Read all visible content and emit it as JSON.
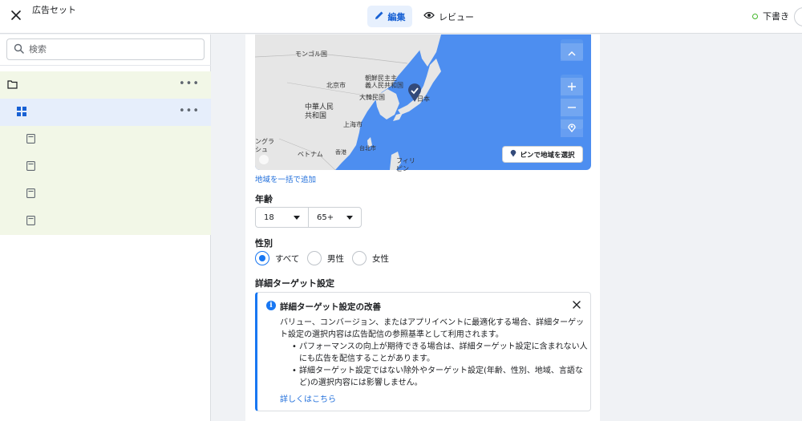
{
  "topbar": {
    "close_icon": "close-icon",
    "title": "広告セット",
    "tabs": [
      {
        "label": "編集",
        "icon": "pencil-icon",
        "active": true
      },
      {
        "label": "レビュー",
        "icon": "eye-icon",
        "active": false
      }
    ],
    "status": "下書き",
    "status_color": "#42b72a"
  },
  "sidebar": {
    "search_placeholder": "検索",
    "tree": [
      {
        "type": "campaign",
        "icon": "folder-icon",
        "more": "•••"
      },
      {
        "type": "ad-set",
        "icon": "grid-icon",
        "more": "•••",
        "selected": true
      },
      {
        "type": "ad",
        "icon": "ad-icon"
      },
      {
        "type": "ad",
        "icon": "ad-icon"
      },
      {
        "type": "ad",
        "icon": "ad-icon"
      },
      {
        "type": "ad",
        "icon": "ad-icon"
      }
    ],
    "row_color": "#f2f7e7",
    "selected_color": "#e6eefb"
  },
  "map": {
    "labels": {
      "mongolia": "モンゴル国",
      "dprk": "朝鮮民主主\n義人民共和国",
      "beijing": "北京市",
      "korea": "大韓民国",
      "japan": "日本",
      "china": "中華人民\n共和国",
      "shanghai": "上海市",
      "bangladesh": "ングラ\nシュ",
      "vietnam": "ベトナム",
      "hongkong": "香港",
      "taipei": "台北市",
      "philippines": "フィリ\nピン"
    },
    "pin_button": "ピンで地域を選択",
    "bulk_add_link": "地域を一括で追加"
  },
  "age": {
    "label": "年齢",
    "min": "18",
    "max": "65+"
  },
  "gender": {
    "label": "性別",
    "options": [
      {
        "label": "すべて",
        "selected": true
      },
      {
        "label": "男性",
        "selected": false
      },
      {
        "label": "女性",
        "selected": false
      }
    ]
  },
  "detailed_targeting": {
    "label": "詳細ターゲット設定",
    "info": {
      "title": "詳細ターゲット設定の改善",
      "body": "バリュー、コンバージョン、またはアプリイベントに最適化する場合、詳細ターゲット設定の選択内容は広告配信の参照基準として利用されます。",
      "bullets": [
        "パフォーマンスの向上が期待できる場合は、詳細ターゲット設定に含まれない人にも広告を配信することがあります。",
        "詳細ターゲット設定ではない除外やターゲット設定(年齢、性別、地域、言語など)の選択内容には影響しません。"
      ],
      "learn_more": "詳しくはこちら",
      "accent": "#1877f2"
    }
  }
}
